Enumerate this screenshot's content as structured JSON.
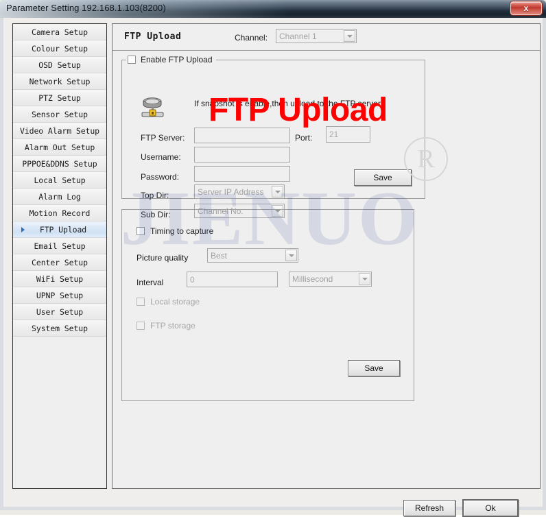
{
  "window": {
    "title": "Parameter Setting 192.168.1.103(8200)",
    "close_glyph": "x"
  },
  "sidebar": {
    "items": [
      {
        "label": "Camera Setup",
        "selected": false
      },
      {
        "label": "Colour Setup",
        "selected": false
      },
      {
        "label": "OSD Setup",
        "selected": false
      },
      {
        "label": "Network Setup",
        "selected": false
      },
      {
        "label": "PTZ Setup",
        "selected": false
      },
      {
        "label": "Sensor Setup",
        "selected": false
      },
      {
        "label": "Video Alarm Setup",
        "selected": false
      },
      {
        "label": "Alarm Out Setup",
        "selected": false
      },
      {
        "label": "PPPOE&DDNS Setup",
        "selected": false
      },
      {
        "label": "Local Setup",
        "selected": false
      },
      {
        "label": "Alarm Log",
        "selected": false
      },
      {
        "label": "Motion Record",
        "selected": false
      },
      {
        "label": "FTP Upload",
        "selected": true
      },
      {
        "label": "Email Setup",
        "selected": false
      },
      {
        "label": "Center Setup",
        "selected": false
      },
      {
        "label": "WiFi Setup",
        "selected": false
      },
      {
        "label": "UPNP Setup",
        "selected": false
      },
      {
        "label": "User Setup",
        "selected": false
      },
      {
        "label": "System Setup",
        "selected": false
      }
    ]
  },
  "main": {
    "page_title": "FTP Upload",
    "channel": {
      "label": "Channel:",
      "value": "Channel 1",
      "options": [
        "Channel 1"
      ]
    },
    "ftp_group": {
      "legend": "Enable FTP Upload",
      "enabled": false,
      "info": "If snapshot is enable,then upload to the FTP server.",
      "icon": "ftp-server-icon",
      "fields": {
        "ftp_server_label": "FTP Server:",
        "ftp_server_value": "",
        "ftp_server_placeholder": "",
        "port_label": "Port:",
        "port_value": "21",
        "username_label": "Username:",
        "username_value": "",
        "password_label": "Password:",
        "password_value": "",
        "top_dir_label": "Top Dir:",
        "top_dir_value": "Server IP Address",
        "top_dir_options": [
          "Server IP Address"
        ],
        "sub_dir_label": "Sub Dir:",
        "sub_dir_value": "Channel No.",
        "sub_dir_options": [
          "Channel No."
        ]
      },
      "save_label": "Save"
    },
    "timing_group": {
      "timing_label": "Timing to capture",
      "timing_checked": false,
      "picture_quality_label": "Picture quality",
      "picture_quality_value": "Best",
      "picture_quality_options": [
        "Best"
      ],
      "interval_label": "Interval",
      "interval_value": "0",
      "interval_unit_value": "Millisecond",
      "interval_unit_options": [
        "Millisecond"
      ],
      "local_storage_label": "Local storage",
      "local_storage_checked": false,
      "ftp_storage_label": "FTP storage",
      "ftp_storage_checked": false,
      "save_label": "Save"
    },
    "overlay_text": "FTP Upload"
  },
  "watermark": {
    "brand": "JIENUO",
    "registered": "R"
  },
  "footer": {
    "refresh_label": "Refresh",
    "ok_label": "Ok"
  },
  "colors": {
    "accent": "#2f6fb5",
    "overlay_red": "#ff0000",
    "titlebar_dark": "#22303d",
    "close_red": "#b93128"
  }
}
